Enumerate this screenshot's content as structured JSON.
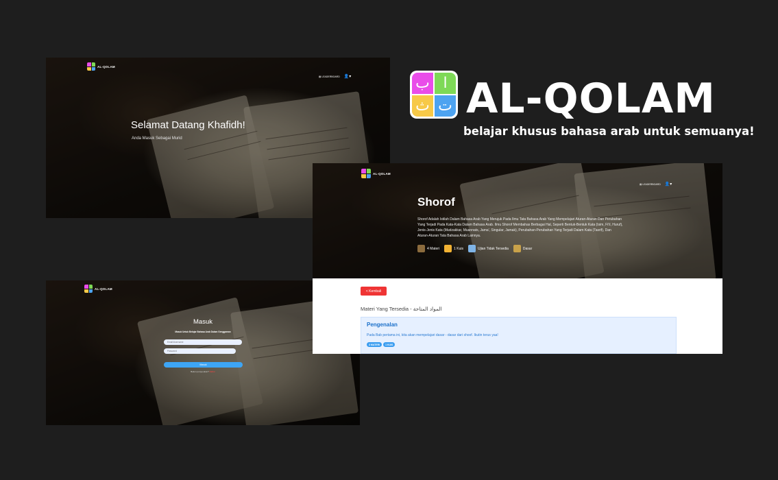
{
  "brand": {
    "name": "AL-QOLAM",
    "tagline": "belajar khusus bahasa arab untuk semuanya!",
    "tile_letters": [
      "ب",
      "ا",
      "ث",
      "ت"
    ],
    "tile_colors": [
      "#e94de9",
      "#7ed957",
      "#f7c948",
      "#4da3f0"
    ]
  },
  "home": {
    "logo_text": "AL-QOLAM",
    "nav_leaderboard": "LEADERBOARD",
    "title": "Selamat Datang Khafidh!",
    "subtitle": "Anda Masuk Sebagai Murid"
  },
  "login": {
    "logo_text": "AL-QOLAM",
    "title": "Masuk",
    "subtitle": "Masuk Untuk Belajar Bahasa Arab Dalam Genggaman",
    "username_placeholder": "Email/Username",
    "password_placeholder": "Password",
    "submit_label": "Masuk",
    "footer_text": "Belum punya akun?",
    "footer_link": "Daftar"
  },
  "course": {
    "logo_text": "AL-QOLAM",
    "nav_leaderboard": "LEADERBOARD",
    "title": "Shorof",
    "description": "Shorof Adalah Istilah Dalam Bahasa Arab Yang Merujuk Pada Ilmu Tata Bahasa Arab Yang Mempelajari Aturan-Aturan Dan Perubahan Yang Terjadi Pada Kata-Kata Dalam Bahasa Arab. Ilmu Shorof Membahas Berbagai Hal, Seperti Bentuk-Bentuk Kata (Isim, Fi'il, Huruf), Jenis-Jenis Kata (Mudzakkar, Muannats, Jama', Singular, Jamak), Perubahan-Perubahan Yang Terjadi Dalam Kata (Tasrif), Dan Aturan-Aturan Tata Bahasa Arab Lainnya.",
    "stats": [
      {
        "label": "4 Materi",
        "icon": "book-stack-icon",
        "color": "#8b6b3d"
      },
      {
        "label": "1 Kuis",
        "icon": "quiz-grid-icon",
        "color": "#f2b233"
      },
      {
        "label": "Ujian Tidak Tersedia",
        "icon": "exam-paper-icon",
        "color": "#7fb4e6"
      },
      {
        "label": "Dasar",
        "icon": "level-bars-icon",
        "color": "#c9a24a"
      }
    ],
    "back_label": "< Kembali",
    "materi_heading": "Materi Yang Tersedia - المواد المتاحة",
    "card": {
      "title": "Pengenalan",
      "desc": "Pada Bab pertama ini, kita akan mempelajari dasar - dasar dari shoof. Ikutin terus yaa!",
      "badges": [
        "3 MATERI",
        "1 KUIS"
      ]
    }
  }
}
